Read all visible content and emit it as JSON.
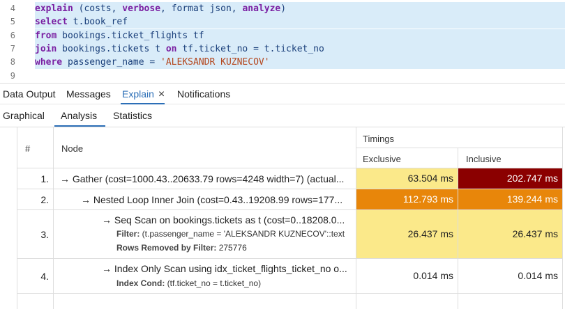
{
  "editor": {
    "lines": [
      {
        "num": "4",
        "selected": true,
        "tokens": [
          {
            "t": "explain",
            "c": "kw"
          },
          {
            "t": " (costs, ",
            "c": ""
          },
          {
            "t": "verbose",
            "c": "kw"
          },
          {
            "t": ", format json, ",
            "c": ""
          },
          {
            "t": "analyze",
            "c": "kw"
          },
          {
            "t": ")",
            "c": ""
          }
        ]
      },
      {
        "num": "5",
        "selected": true,
        "tokens": [
          {
            "t": "select",
            "c": "kw"
          },
          {
            "t": " t.book_ref",
            "c": ""
          }
        ]
      },
      {
        "num": "6",
        "selected": true,
        "tokens": [
          {
            "t": "from",
            "c": "kw"
          },
          {
            "t": " bookings.ticket_flights tf",
            "c": ""
          }
        ]
      },
      {
        "num": "7",
        "selected": true,
        "tokens": [
          {
            "t": "join",
            "c": "kw"
          },
          {
            "t": " bookings.tickets t ",
            "c": ""
          },
          {
            "t": "on",
            "c": "kw"
          },
          {
            "t": " tf.ticket_no = t.ticket_no",
            "c": ""
          }
        ]
      },
      {
        "num": "8",
        "selected": true,
        "tokens": [
          {
            "t": "where",
            "c": "kw"
          },
          {
            "t": " passenger_name = ",
            "c": ""
          },
          {
            "t": "'ALEKSANDR KUZNECOV'",
            "c": "str"
          }
        ]
      },
      {
        "num": "9",
        "selected": false,
        "tokens": []
      }
    ]
  },
  "output_tabs": {
    "data_output": "Data Output",
    "messages": "Messages",
    "explain": "Explain",
    "explain_close": "×",
    "notifications": "Notifications"
  },
  "explain_tabs": {
    "graphical": "Graphical",
    "analysis": "Analysis",
    "statistics": "Statistics"
  },
  "table": {
    "col_num": "#",
    "col_node": "Node",
    "col_timings": "Timings",
    "col_exclusive": "Exclusive",
    "col_inclusive": "Inclusive",
    "rows": [
      {
        "num": "1.",
        "node": "→ Gather (cost=1000.43..20633.79 rows=4248 width=7) (actual...",
        "exclusive": "63.504 ms",
        "inclusive": "202.747 ms",
        "exclusive_color": "#fbe98a",
        "inclusive_color": "#8b0000"
      },
      {
        "num": "2.",
        "node": "→ Nested Loop Inner Join (cost=0.43..19208.99 rows=177...",
        "exclusive": "112.793 ms",
        "inclusive": "139.244 ms",
        "exclusive_color": "#e8860a",
        "inclusive_color": "#e8860a"
      },
      {
        "num": "3.",
        "node": "→ Seq Scan on bookings.tickets as t (cost=0..18208.0...",
        "filter_label": "Filter:",
        "filter_value": " (t.passenger_name = 'ALEKSANDR KUZNECOV'::text",
        "removed_label": "Rows Removed by Filter:",
        "removed_value": " 275776",
        "exclusive": "26.437 ms",
        "inclusive": "26.437 ms",
        "exclusive_color": "#fbe98a",
        "inclusive_color": "#fbe98a"
      },
      {
        "num": "4.",
        "node": "→ Index Only Scan using idx_ticket_flights_ticket_no o...",
        "cond_label": "Index Cond:",
        "cond_value": " (tf.ticket_no = t.ticket_no)",
        "exclusive": "0.014 ms",
        "inclusive": "0.014 ms",
        "exclusive_color": "#ffffff",
        "inclusive_color": "#ffffff"
      }
    ]
  }
}
